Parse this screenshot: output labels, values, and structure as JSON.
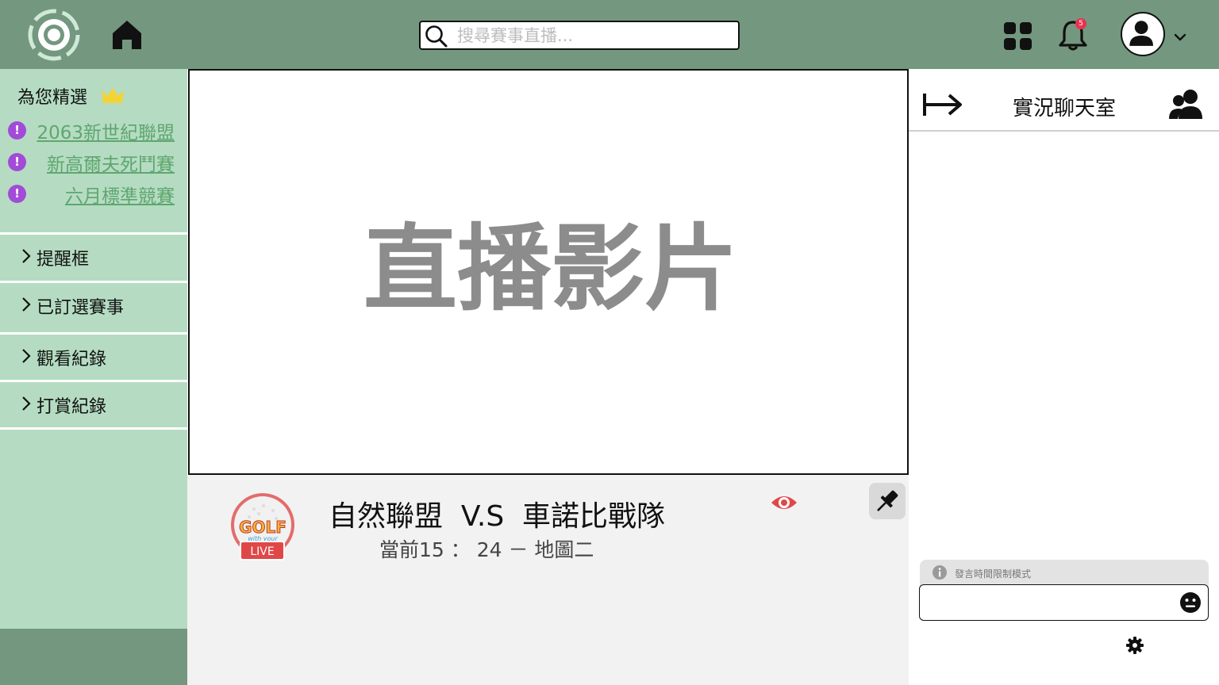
{
  "header": {
    "search_placeholder": "搜尋賽事直播...",
    "notification_count": "5",
    "colors": {
      "topbar": "#74977f",
      "badge": "#e8324f"
    }
  },
  "sidebar": {
    "featured_title": "為您精選",
    "featured_items": [
      {
        "label": "2063新世紀聯盟"
      },
      {
        "label": "新高爾夫死鬥賽"
      },
      {
        "label": "六月標準競賽"
      }
    ],
    "nav_items": [
      {
        "label": "提醒框"
      },
      {
        "label": "已訂選賽事"
      },
      {
        "label": "觀看紀錄"
      },
      {
        "label": "打賞紀錄"
      }
    ],
    "colors": {
      "background": "#b5dcc2",
      "link": "#5fa66f",
      "dot": "#a24bd8"
    }
  },
  "video": {
    "placeholder_label": "直播影片"
  },
  "match": {
    "title": "自然聯盟  V.S  車諾比戰隊",
    "subtitle": "當前15 ： 24 － 地圖二",
    "live_badge": "LIVE",
    "logo_text": "GOLF with your FRIENDS"
  },
  "chat": {
    "title": "實況聊天室",
    "mode_notice": "發言時間限制模式",
    "input_value": ""
  }
}
